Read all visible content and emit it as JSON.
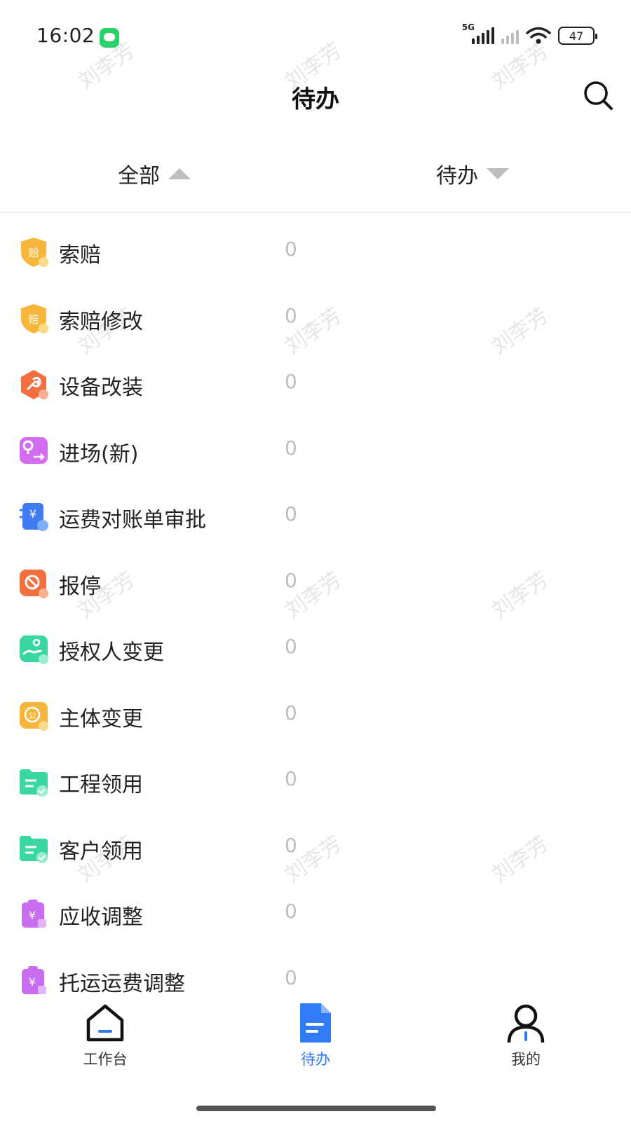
{
  "status_bar": {
    "time": "16:02",
    "network": "5G",
    "battery": "47"
  },
  "header": {
    "title": "待办",
    "search_icon": "search-icon"
  },
  "filters": {
    "all_label": "全部",
    "status_label": "待办"
  },
  "tasks": [
    {
      "label": "索赔",
      "count": "0",
      "icon": "claim-shield-icon",
      "color": "#f6b73c"
    },
    {
      "label": "索赔修改",
      "count": "0",
      "icon": "claim-shield-icon",
      "color": "#f6b73c"
    },
    {
      "label": "设备改装",
      "count": "0",
      "icon": "wrench-hexagon-icon",
      "color": "#f2703f"
    },
    {
      "label": "进场(新)",
      "count": "0",
      "icon": "location-entry-icon",
      "color": "#d46cf0"
    },
    {
      "label": "运费对账单审批",
      "count": "0",
      "icon": "freight-bill-icon",
      "color": "#3f7cf2"
    },
    {
      "label": "报停",
      "count": "0",
      "icon": "stop-sign-icon",
      "color": "#f2703f"
    },
    {
      "label": "授权人变更",
      "count": "0",
      "icon": "hand-key-icon",
      "color": "#3ad6a4"
    },
    {
      "label": "主体变更",
      "count": "0",
      "icon": "entity-swap-icon",
      "color": "#f6b73c"
    },
    {
      "label": "工程领用",
      "count": "0",
      "icon": "folder-check-icon",
      "color": "#3ad6a4"
    },
    {
      "label": "客户领用",
      "count": "0",
      "icon": "folder-check-icon",
      "color": "#3ad6a4"
    },
    {
      "label": "应收调整",
      "count": "0",
      "icon": "yuan-clipboard-icon",
      "color": "#c86cf0"
    },
    {
      "label": "托运运费调整",
      "count": "0",
      "icon": "yuan-clipboard-icon",
      "color": "#c86cf0"
    }
  ],
  "watermark": "刘李芳",
  "bottom_nav": {
    "workbench_label": "工作台",
    "todo_label": "待办",
    "mine_label": "我的",
    "active_color": "#2f7cf6"
  }
}
